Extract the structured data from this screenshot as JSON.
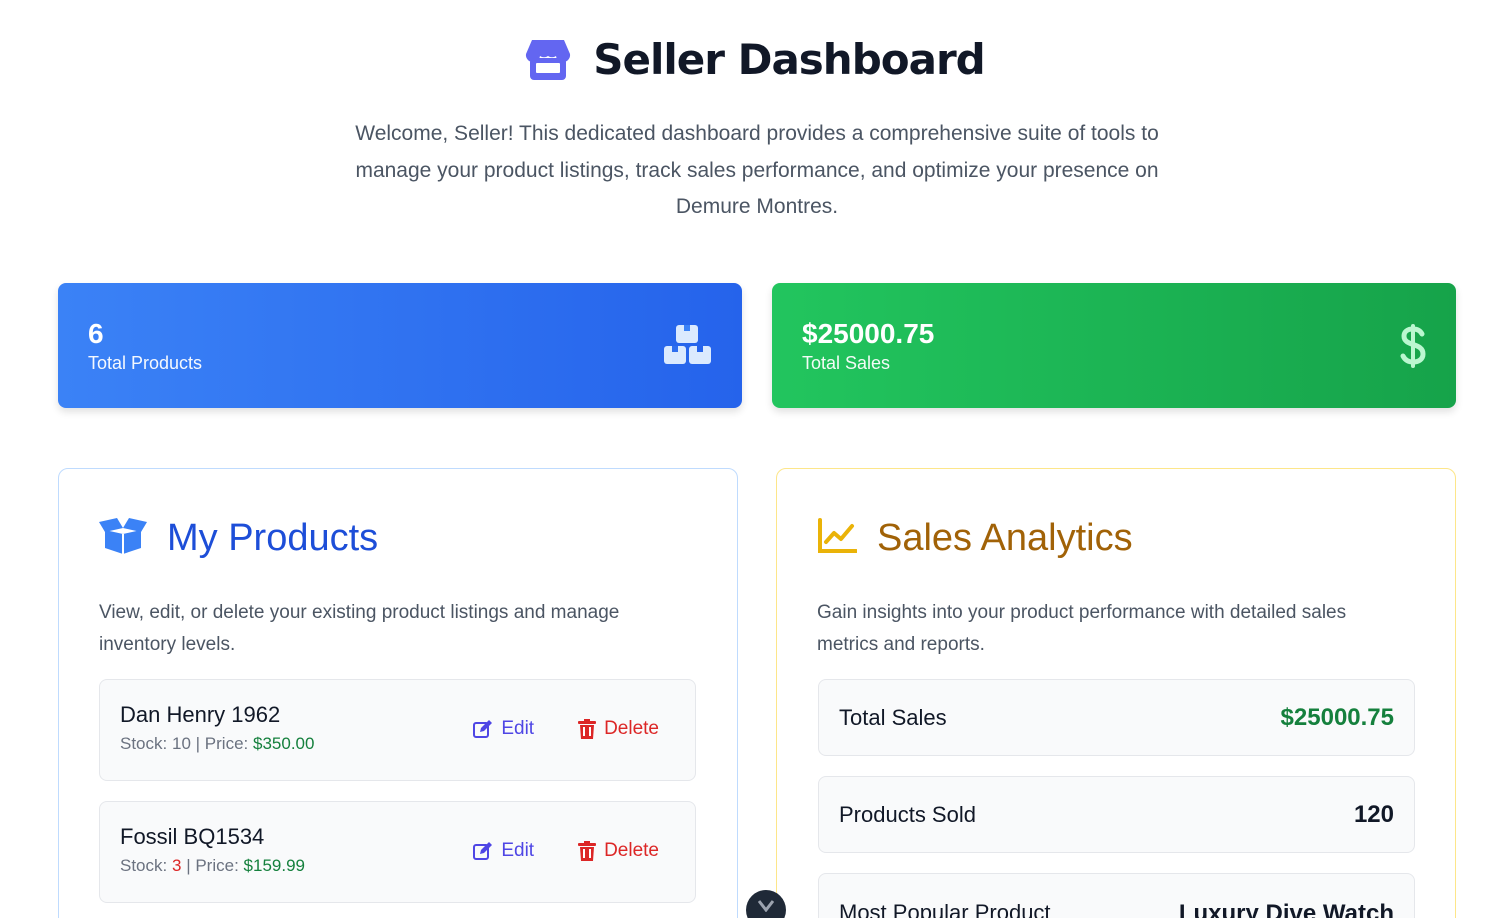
{
  "header": {
    "title": "Seller Dashboard",
    "subtitle": "Welcome, Seller! This dedicated dashboard provides a comprehensive suite of tools to manage your product listings, track sales performance, and optimize your presence on Demure Montres."
  },
  "stats": [
    {
      "value": "6",
      "label": "Total Products",
      "icon": "boxes-icon"
    },
    {
      "value": "$25000.75",
      "label": "Total Sales",
      "icon": "dollar-icon"
    }
  ],
  "products_panel": {
    "title": "My Products",
    "description": "View, edit, or delete your existing product listings and manage inventory levels.",
    "stock_label": "Stock:",
    "price_label": "Price:",
    "separator": "|",
    "edit_label": "Edit",
    "delete_label": "Delete",
    "items": [
      {
        "name": "Dan Henry 1962",
        "stock": "10",
        "price": "$350.00"
      },
      {
        "name": "Fossil BQ1534",
        "stock": "3",
        "price": "$159.99"
      }
    ]
  },
  "analytics_panel": {
    "title": "Sales Analytics",
    "description": "Gain insights into your product performance with detailed sales metrics and reports.",
    "metrics": [
      {
        "label": "Total Sales",
        "value": "$25000.75"
      },
      {
        "label": "Products Sold",
        "value": "120"
      },
      {
        "label": "Most Popular Product",
        "value": "Luxury Dive Watch"
      }
    ]
  },
  "colors": {
    "blue_card": "#2563eb",
    "green_card": "#16a34a",
    "products_title": "#1d4ed8",
    "analytics_title": "#a16207",
    "edit": "#4f46e5",
    "delete": "#dc2626"
  }
}
